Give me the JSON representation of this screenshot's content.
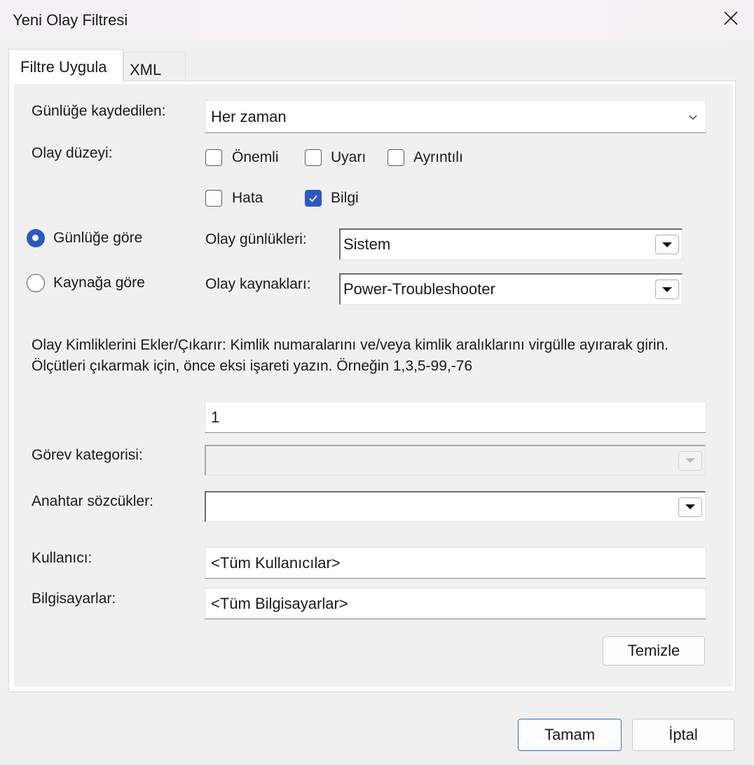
{
  "window": {
    "title": "Yeni Olay Filtresi"
  },
  "tabs": [
    {
      "label": "Filtre Uygula",
      "active": true
    },
    {
      "label": "XML",
      "active": false
    }
  ],
  "form": {
    "logged_label": "Günlüğe kaydedilen:",
    "logged_value": "Her zaman",
    "event_level_label": "Olay düzeyi:",
    "levels": [
      {
        "label": "Önemli",
        "checked": false
      },
      {
        "label": "Uyarı",
        "checked": false
      },
      {
        "label": "Ayrıntılı",
        "checked": false
      },
      {
        "label": "Hata",
        "checked": false
      },
      {
        "label": "Bilgi",
        "checked": true
      }
    ],
    "by_log_label": "Günlüğe göre",
    "by_source_label": "Kaynağa göre",
    "event_logs_label": "Olay günlükleri:",
    "event_logs_value": "Sistem",
    "event_sources_label": "Olay kaynakları:",
    "event_sources_value": "Power-Troubleshooter",
    "ids_description": "Olay Kimliklerini Ekler/Çıkarır: Kimlik numaralarını ve/veya kimlik aralıklarını virgülle ayırarak girin. Ölçütleri çıkarmak için, önce eksi işareti yazın. Örneğin 1,3,5-99,-76",
    "ids_value": "1",
    "task_category_label": "Görev kategorisi:",
    "task_category_value": "",
    "keywords_label": "Anahtar sözcükler:",
    "keywords_value": "",
    "user_label": "Kullanıcı:",
    "user_value": "<Tüm Kullanıcılar>",
    "computers_label": "Bilgisayarlar:",
    "computers_value": "<Tüm Bilgisayarlar>",
    "clear_button": "Temizle"
  },
  "footer": {
    "ok_button": "Tamam",
    "cancel_button": "İptal"
  },
  "colors": {
    "accent": "#2b59c3"
  }
}
